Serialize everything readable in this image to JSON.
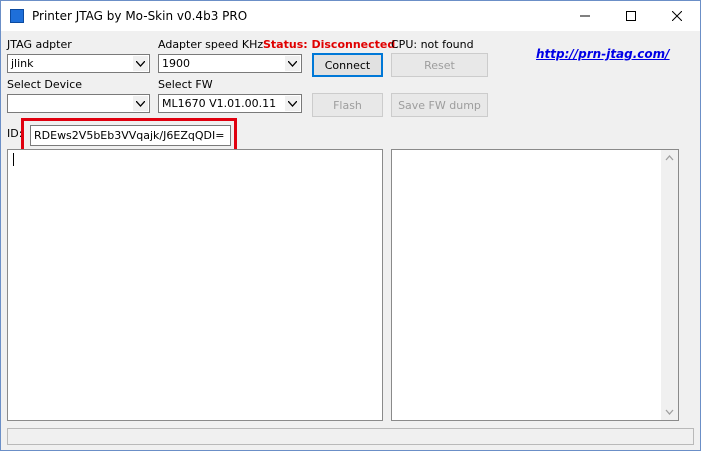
{
  "window": {
    "title": "Printer JTAG by Mo-Skin v0.4b3 PRO",
    "controls": [
      "minimize-icon",
      "maximize-icon",
      "close-icon"
    ]
  },
  "labels": {
    "jtag_adapter": "JTAG adpter",
    "adapter_speed": "Adapter speed KHz",
    "status": "Status: Disconnected",
    "cpu": "CPU: not found",
    "select_device": "Select Device",
    "select_fw": "Select FW",
    "id": "ID:"
  },
  "fields": {
    "jtag_adapter_value": "jlink",
    "adapter_speed_value": "1900",
    "device_value": "",
    "fw_value": "ML1670 V1.01.00.11",
    "id_value": "RDEws2V5bEb3VVqajk/J6EZqQDI="
  },
  "buttons": {
    "connect": "Connect",
    "reset": "Reset",
    "flash": "Flash",
    "save_fw_dump": "Save FW dump"
  },
  "link": "http://prn-jtag.com/",
  "colors": {
    "status": "#e00000",
    "link": "#0000e6",
    "highlight": "#e0000f"
  }
}
